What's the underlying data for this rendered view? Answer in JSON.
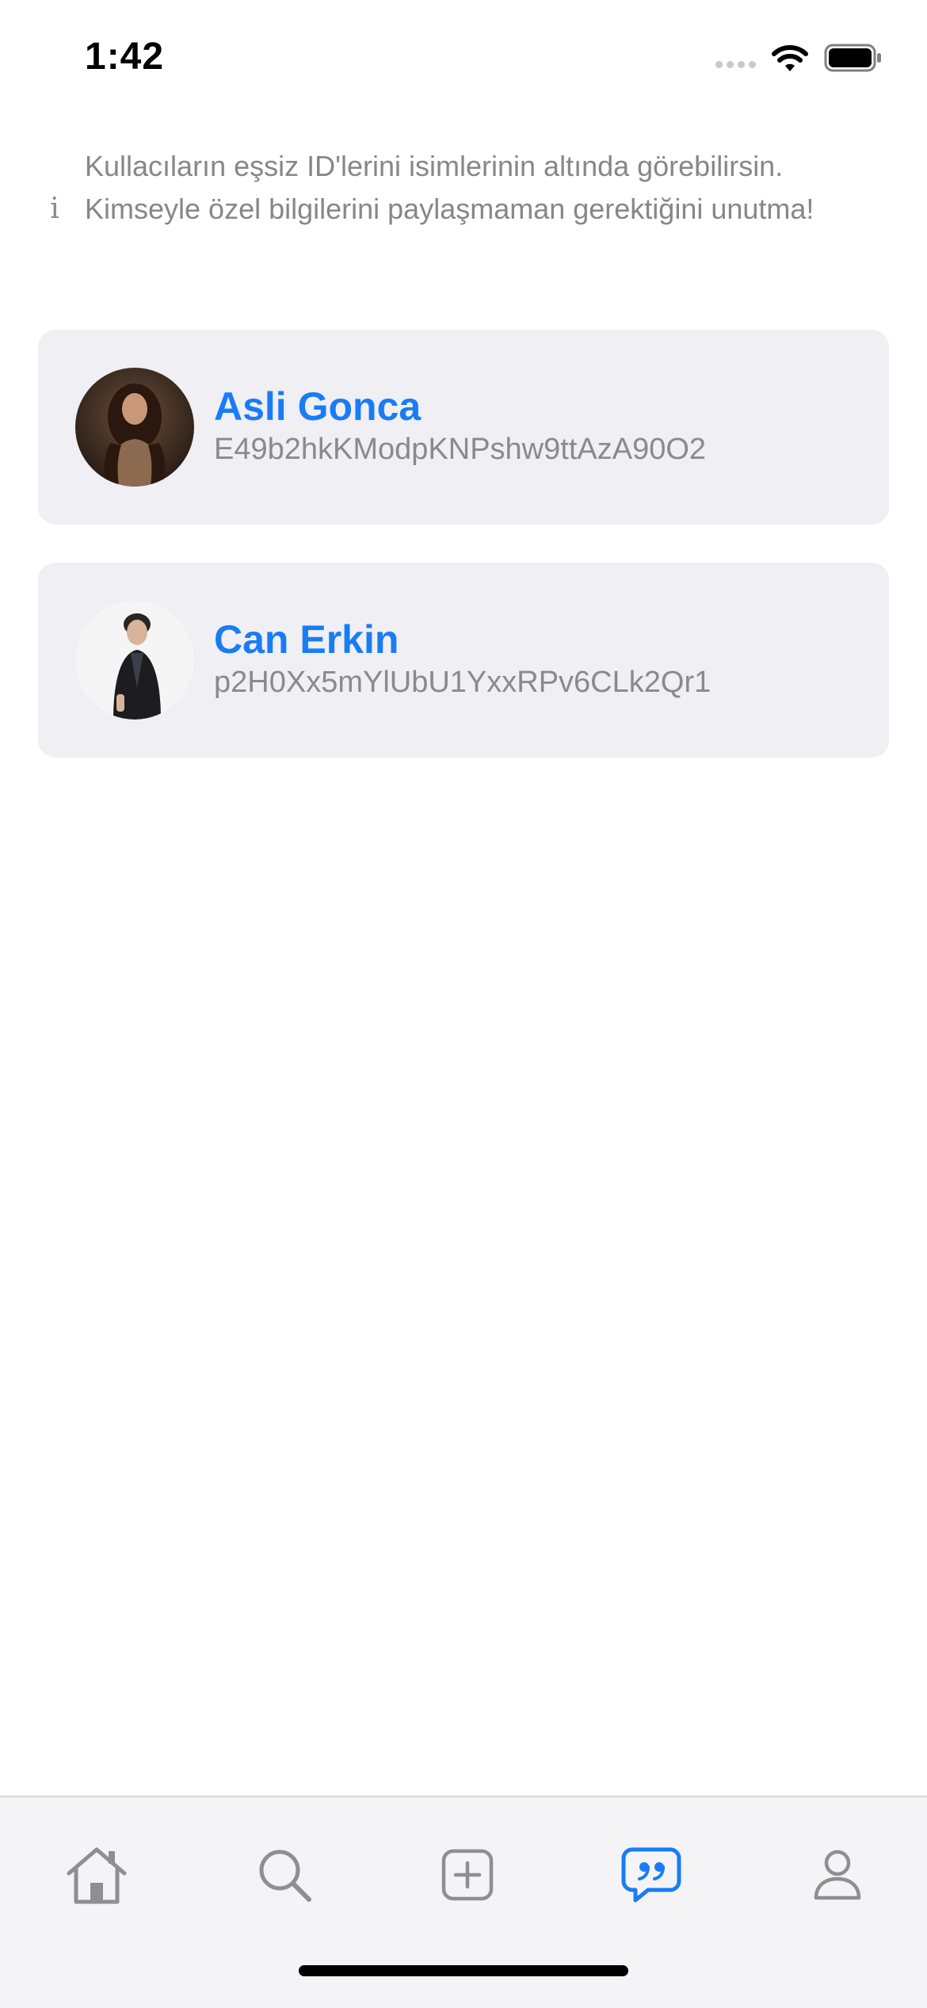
{
  "status_bar": {
    "time": "1:42"
  },
  "notice": {
    "icon": "info-icon",
    "text": "Kullacıların eşsiz ID'lerini isimlerinin altında görebilirsin. Kimseyle özel bilgilerini paylaşmaman gerektiğini unutma!"
  },
  "users": [
    {
      "name": "Asli Gonca",
      "id": "E49b2hkKModpKNPshw9ttAzA90O2"
    },
    {
      "name": "Can Erkin",
      "id": "p2H0Xx5mYlUbU1YxxRPv6CLk2Qr1"
    }
  ],
  "tab_bar": {
    "items": [
      {
        "icon": "home-icon",
        "active": false
      },
      {
        "icon": "search-icon",
        "active": false
      },
      {
        "icon": "add-square-icon",
        "active": false
      },
      {
        "icon": "chat-quote-icon",
        "active": true
      },
      {
        "icon": "profile-icon",
        "active": false
      }
    ],
    "active_color": "#1a7cf5",
    "inactive_color": "#8e8e93"
  },
  "colors": {
    "accent": "#1a7cf5",
    "card_background": "#efeff4",
    "secondary_text": "#8a8a8e"
  }
}
